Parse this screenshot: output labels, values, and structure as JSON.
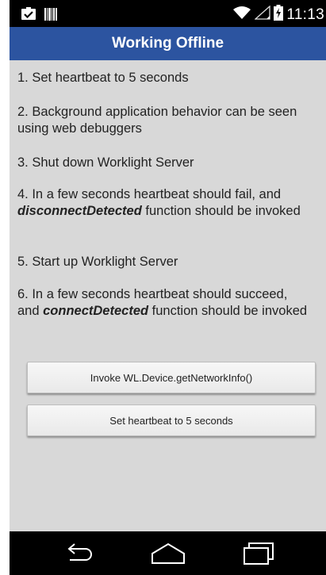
{
  "status_bar": {
    "time": "11:13",
    "icons": [
      "clipboard-check-icon",
      "barcode-icon",
      "wifi-icon",
      "signal-icon",
      "battery-charging-icon"
    ]
  },
  "app": {
    "title": "Working Offline"
  },
  "steps": {
    "s1": "1. Set heartbeat to 5 seconds",
    "s2": "2. Background application behavior can be seen using web debuggers",
    "s3": "3. Shut down Worklight Server",
    "s4_pre": "4. In a few seconds heartbeat should fail, and ",
    "s4_em": "disconnectDetected",
    "s4_post": " function should be invoked",
    "s5": "5. Start up Worklight Server",
    "s6_pre": "6. In a few seconds heartbeat should succeed, and ",
    "s6_em": "connectDetected",
    "s6_post": " function should be invoked"
  },
  "buttons": {
    "network_info": "Invoke WL.Device.getNetworkInfo()",
    "heartbeat": "Set heartbeat to 5 seconds"
  },
  "nav_bar": {
    "icons": [
      "back-icon",
      "home-icon",
      "recent-apps-icon"
    ]
  },
  "colors": {
    "title_bar": "#2c54a0",
    "content_bg": "#d8d8d8"
  }
}
